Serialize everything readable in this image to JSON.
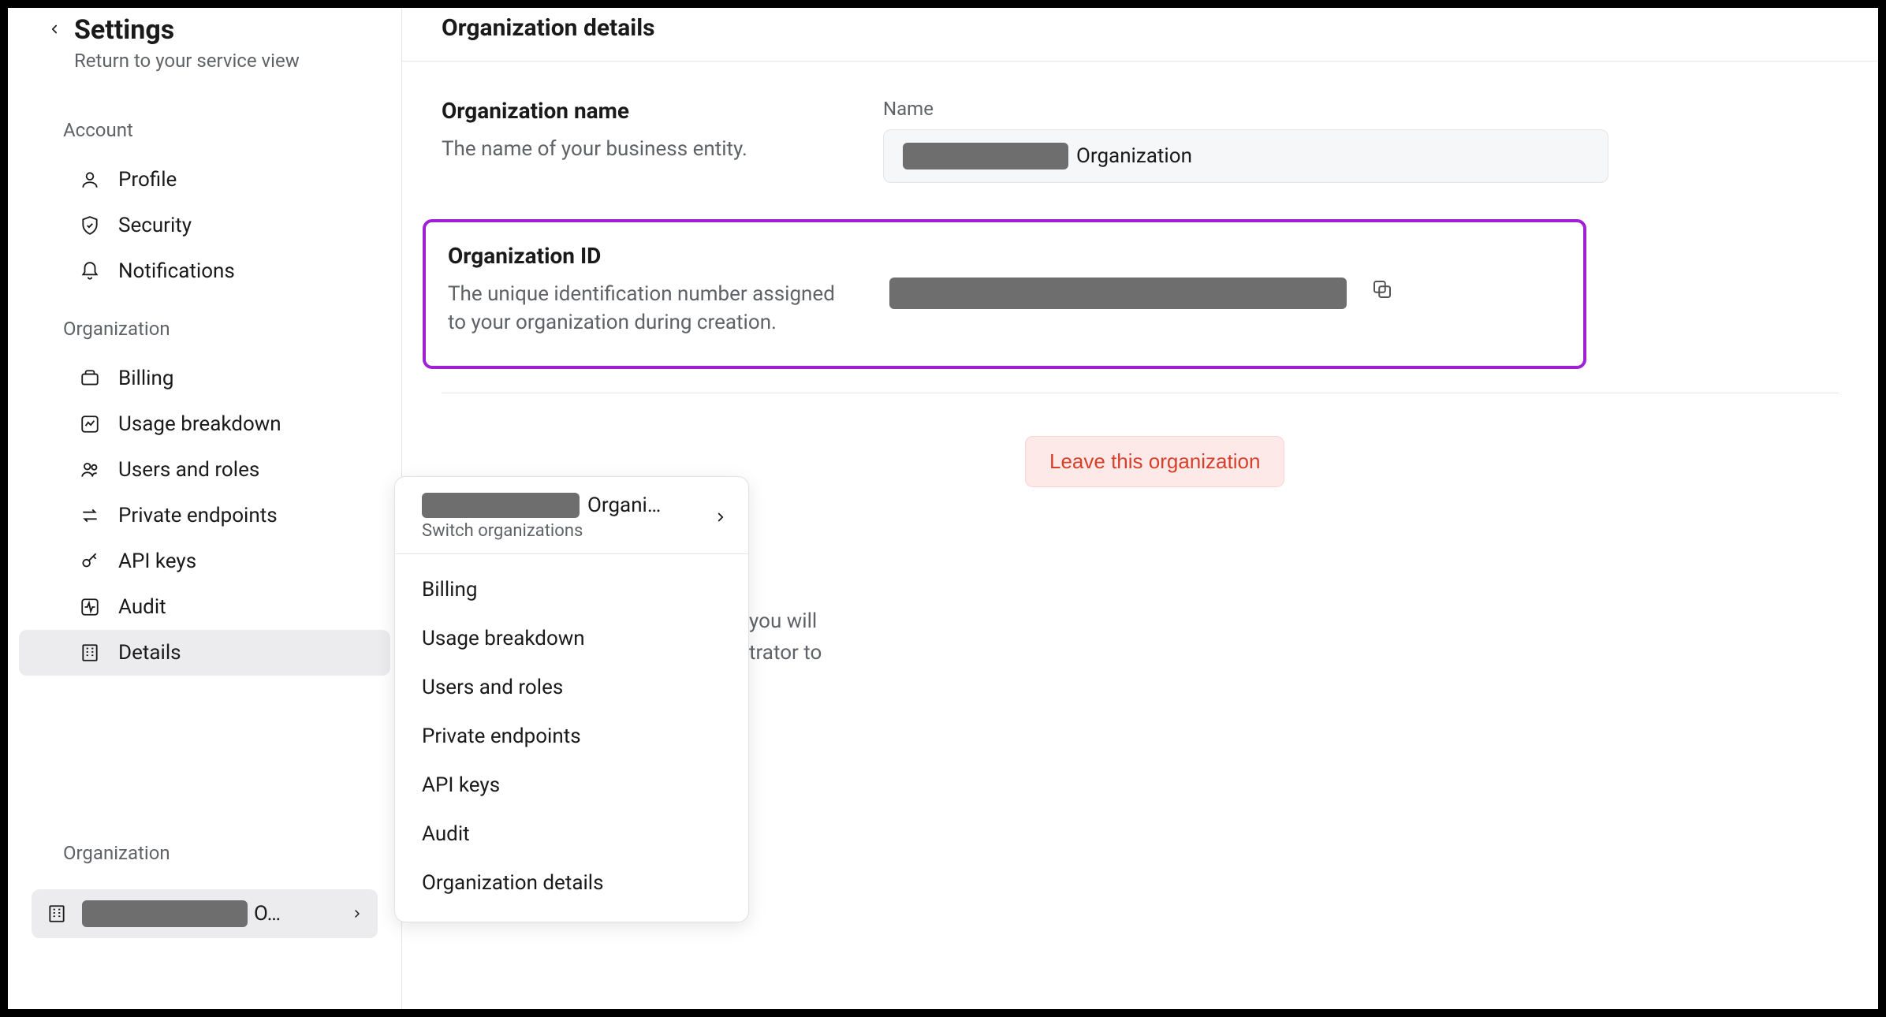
{
  "sidebar": {
    "title": "Settings",
    "subtitle": "Return to your service view",
    "account_label": "Account",
    "org_label": "Organization",
    "items_account": [
      {
        "label": "Profile"
      },
      {
        "label": "Security"
      },
      {
        "label": "Notifications"
      }
    ],
    "items_org": [
      {
        "label": "Billing"
      },
      {
        "label": "Usage breakdown"
      },
      {
        "label": "Users and roles"
      },
      {
        "label": "Private endpoints"
      },
      {
        "label": "API keys"
      },
      {
        "label": "Audit"
      },
      {
        "label": "Details"
      }
    ],
    "bottom_org_label": "Organization",
    "bottom_org_name_suffix": "O…"
  },
  "main": {
    "title": "Organization details",
    "org_name": {
      "heading": "Organization name",
      "desc": "The name of your business entity.",
      "field_label": "Name",
      "value_suffix": "Organization"
    },
    "org_id": {
      "heading": "Organization ID",
      "desc": "The unique identification number assigned to your organization during creation."
    },
    "leave": {
      "desc_right1": "you will",
      "desc_right2": "trator to",
      "button": "Leave this organization"
    }
  },
  "popover": {
    "org_suffix": "Organi…",
    "switch_label": "Switch organizations",
    "items": [
      "Billing",
      "Usage breakdown",
      "Users and roles",
      "Private endpoints",
      "API keys",
      "Audit",
      "Organization details"
    ]
  }
}
